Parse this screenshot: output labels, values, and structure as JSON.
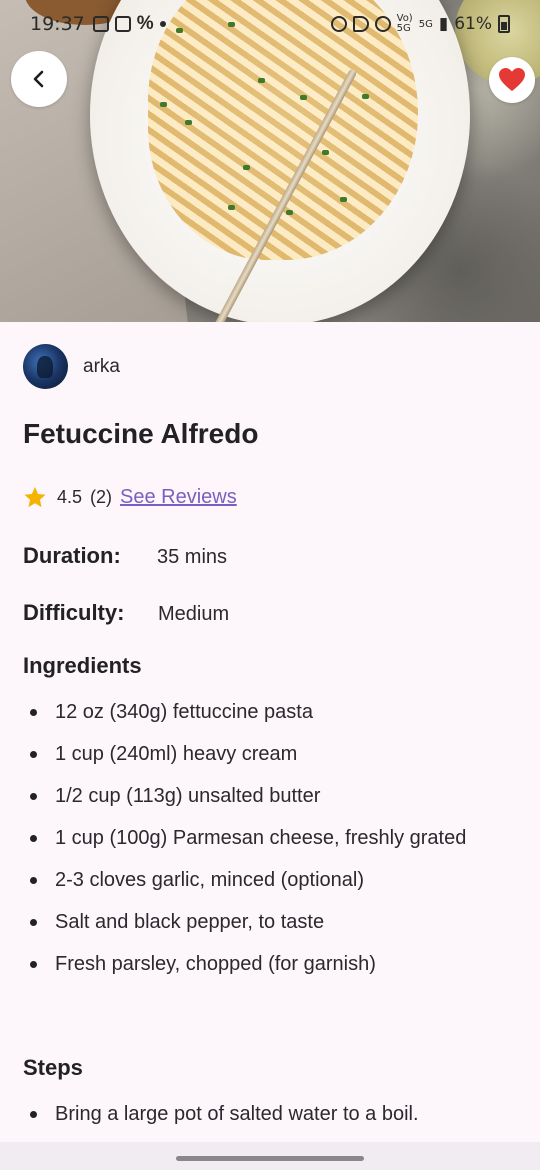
{
  "status_bar": {
    "time": "19:37",
    "battery": "61%"
  },
  "nav": {
    "back_icon": "chevron-left-icon",
    "favorite_icon": "heart-icon",
    "favorite_color": "#e53935"
  },
  "recipe": {
    "author": "arka",
    "title": "Fetuccine Alfredo",
    "rating": "4.5",
    "review_count": "(2)",
    "see_reviews_label": "See Reviews",
    "duration_label": "Duration:",
    "duration_value": "35 mins",
    "difficulty_label": "Difficulty:",
    "difficulty_value": "Medium",
    "ingredients_title": "Ingredients",
    "ingredients": [
      "12 oz (340g) fettuccine pasta",
      "1 cup (240ml) heavy cream",
      "1/2 cup (113g) unsalted butter",
      "1 cup (100g) Parmesan cheese, freshly grated",
      "2-3 cloves garlic, minced (optional)",
      "Salt and black pepper, to taste",
      "Fresh parsley, chopped (for garnish)"
    ],
    "steps_title": "Steps",
    "steps": [
      "Bring a large pot of salted water to a boil."
    ]
  },
  "colors": {
    "background": "#fdf6fb",
    "link": "#7a5fc2",
    "star": "#f5b400"
  }
}
